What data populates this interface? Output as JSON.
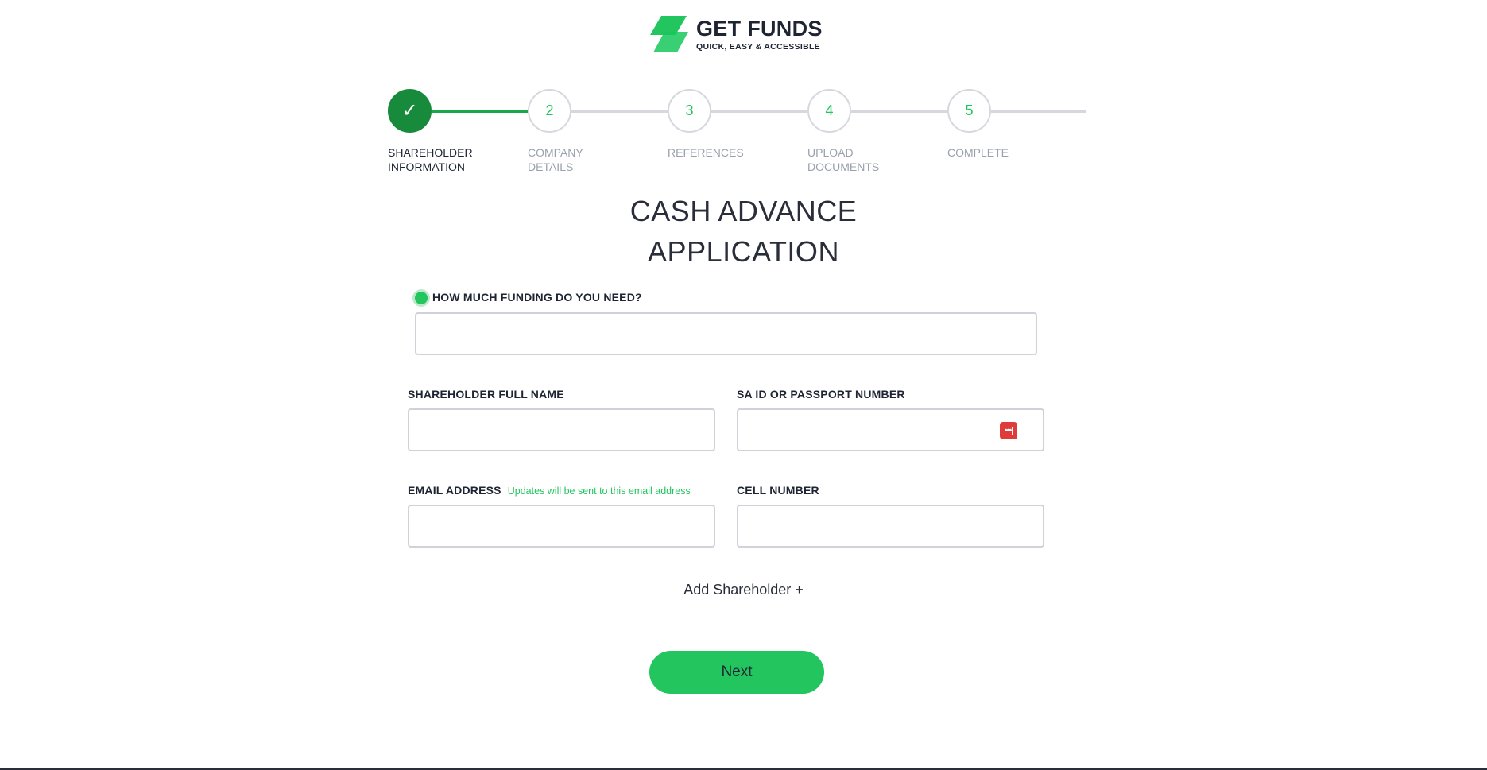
{
  "brand": {
    "title": "GET FUNDS",
    "tagline": "QUICK, EASY & ACCESSIBLE",
    "accent_color": "#22c55e",
    "dark_green": "#178a3c"
  },
  "stepper": {
    "steps": [
      {
        "number": "✓",
        "label_line1": "SHAREHOLDER",
        "label_line2": "INFORMATION",
        "status": "done"
      },
      {
        "number": "2",
        "label_line1": "COMPANY",
        "label_line2": "DETAILS",
        "status": "pending"
      },
      {
        "number": "3",
        "label_line1": "REFERENCES",
        "label_line2": "",
        "status": "pending"
      },
      {
        "number": "4",
        "label_line1": "UPLOAD",
        "label_line2": "DOCUMENTS",
        "status": "pending"
      },
      {
        "number": "5",
        "label_line1": "COMPLETE",
        "label_line2": "",
        "status": "pending"
      }
    ]
  },
  "heading": {
    "line1": "CASH ADVANCE",
    "line2": "APPLICATION"
  },
  "form": {
    "funding": {
      "label": "HOW MUCH FUNDING DO YOU NEED?",
      "value": ""
    },
    "full_name": {
      "label": "SHAREHOLDER FULL NAME",
      "value": ""
    },
    "id_number": {
      "label": "SA ID OR PASSPORT NUMBER",
      "value": "",
      "icon": "password-manager-icon"
    },
    "email": {
      "label": "EMAIL ADDRESS",
      "hint": "Updates will be sent to this email address",
      "value": ""
    },
    "cell": {
      "label": "CELL NUMBER",
      "value": ""
    }
  },
  "actions": {
    "add_shareholder": "Add Shareholder +",
    "next": "Next"
  }
}
